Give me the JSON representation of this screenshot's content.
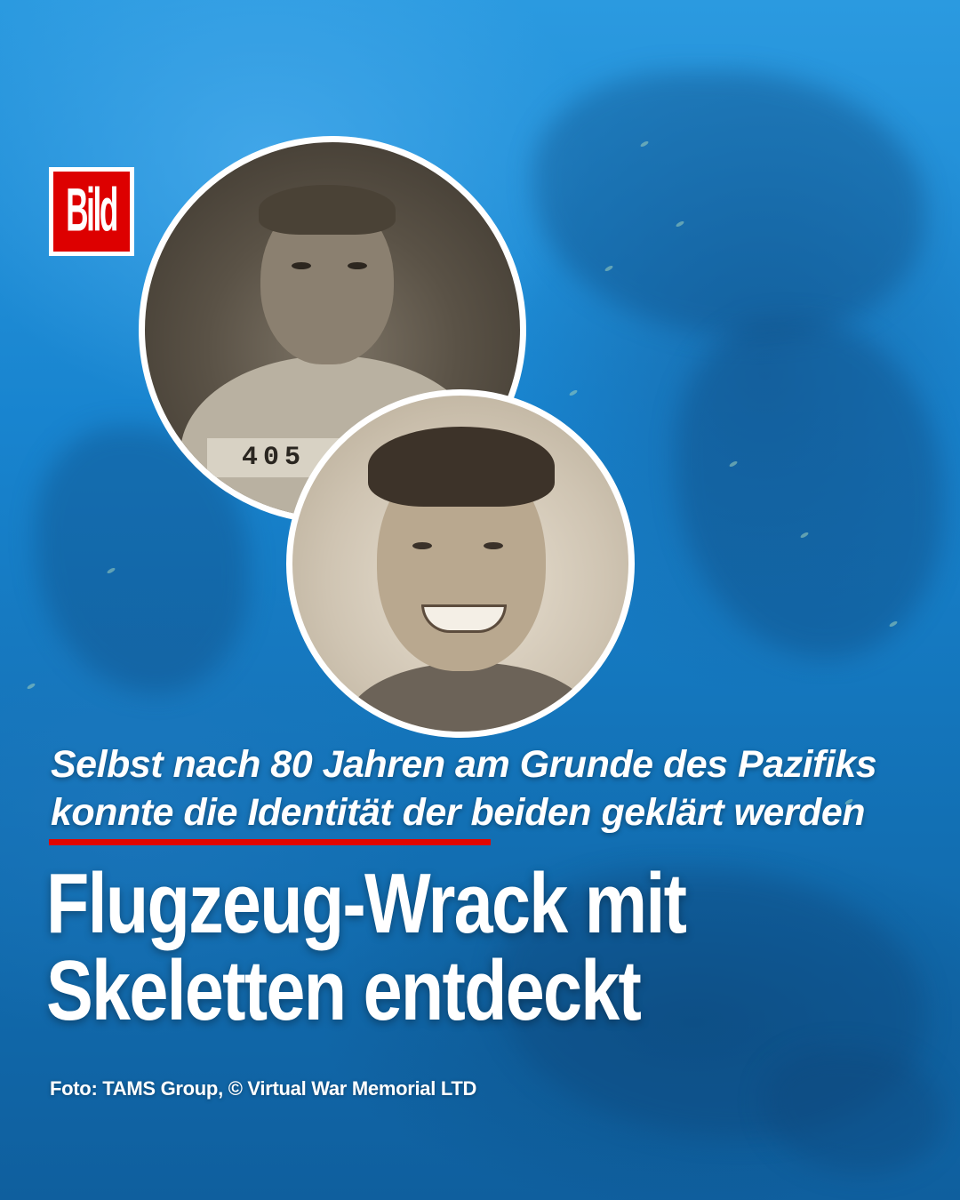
{
  "brand": {
    "logo_text": "Bild",
    "logo_color": "#dd0000"
  },
  "photos": [
    {
      "name": "portrait-older-man",
      "tag_text": "405"
    },
    {
      "name": "portrait-young-man"
    }
  ],
  "subtitle": {
    "line1": "Selbst nach 80 Jahren am Grunde des Pazifiks",
    "line2": "konnte die Identität der beiden geklärt werden"
  },
  "accent_color": "#e10600",
  "headline": {
    "line1": "Flugzeug-Wrack mit",
    "line2": "Skeletten entdeckt"
  },
  "credit": "Foto: TAMS Group, © Virtual War Memorial LTD"
}
